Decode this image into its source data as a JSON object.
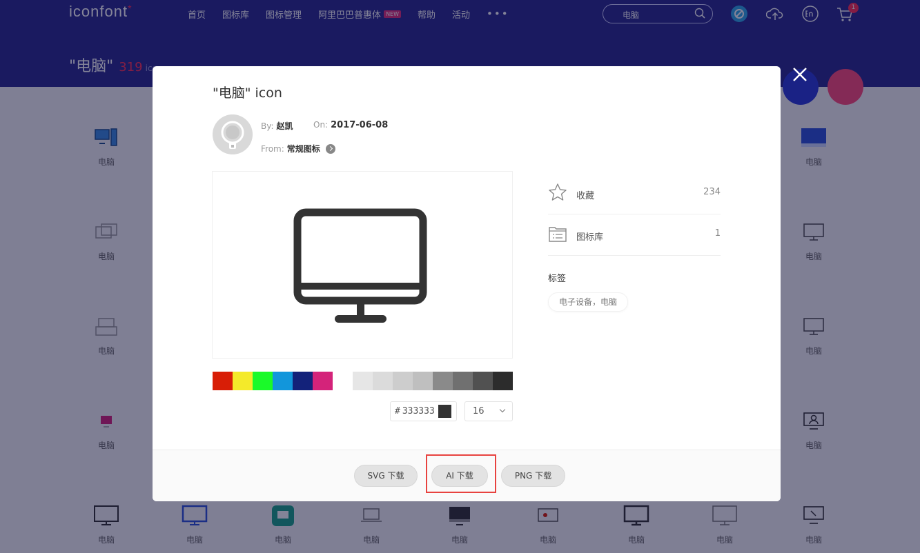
{
  "header": {
    "logo_text": "iconfont",
    "logo_mark": "*",
    "nav": [
      {
        "label": "首页"
      },
      {
        "label": "图标库"
      },
      {
        "label": "图标管理"
      },
      {
        "label": "阿里巴巴普惠体",
        "badge": "NEW"
      },
      {
        "label": "帮助"
      },
      {
        "label": "活动"
      }
    ],
    "nav_more": "•••",
    "search_value": "电脑",
    "cart_count": "1",
    "icons": [
      "search-icon",
      "brand-icon",
      "upload-cloud-icon",
      "language-en-icon",
      "cart-icon"
    ]
  },
  "page": {
    "title": "\"电脑\"",
    "count": "319",
    "count_unit": "icons"
  },
  "grid_label": "电脑",
  "modal": {
    "title": "\"电脑\" icon",
    "by_label": "By:",
    "author": "赵凯",
    "on_label": "On:",
    "date": "2017-06-08",
    "from_label": "From:",
    "source": "常规图标",
    "palette": [
      "#d81e06",
      "#f4ea2a",
      "#1afa29",
      "#1296db",
      "#13227a",
      "#d4237a",
      "#ffffff",
      "#e6e6e6",
      "#dbdbdb",
      "#cdcdcd",
      "#bfbfbf",
      "#8a8a8a",
      "#707070",
      "#515151",
      "#2c2c2c"
    ],
    "hex_prefix": "#",
    "hex_value": "333333",
    "current_color": "#333333",
    "size_value": "16",
    "stats": {
      "favorite_label": "收藏",
      "favorite_count": "234",
      "library_label": "图标库",
      "library_count": "1"
    },
    "tags_title": "标签",
    "tags": "电子设备，电脑",
    "buttons": {
      "svg": "SVG 下载",
      "ai": "AI 下载",
      "png": "PNG 下载"
    }
  }
}
